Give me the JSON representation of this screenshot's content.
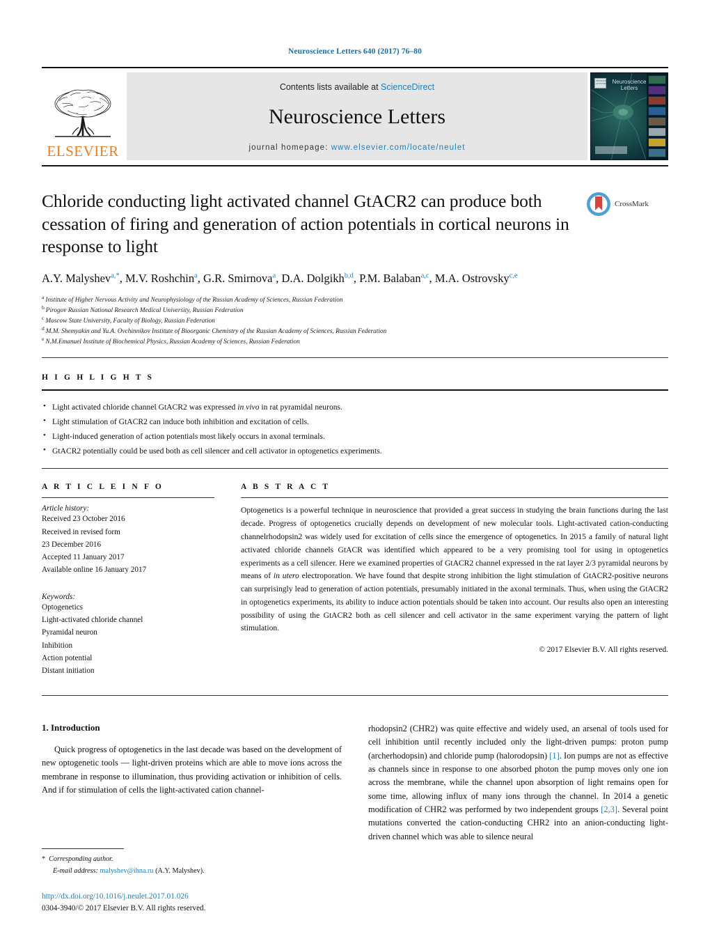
{
  "running_head": "Neuroscience Letters 640 (2017) 76–80",
  "masthead": {
    "publisher": "ELSEVIER",
    "contents_prefix": "Contents lists available at ",
    "contents_link": "ScienceDirect",
    "journal_title": "Neuroscience Letters",
    "homepage_prefix": "journal homepage: ",
    "homepage_url": "www.elsevier.com/locate/neulet",
    "cover_title": "Neuroscience Letters",
    "cover_badge": "NEUROSCIENCE LETTERS"
  },
  "article": {
    "title": "Chloride conducting light activated channel GtACR2 can produce both cessation of firing and generation of action potentials in cortical neurons in response to light",
    "crossmark_label": "CrossMark",
    "authors": [
      {
        "name": "A.Y. Malyshev",
        "marks": "a,*"
      },
      {
        "name": "M.V. Roshchin",
        "marks": "a"
      },
      {
        "name": "G.R. Smirnova",
        "marks": "a"
      },
      {
        "name": "D.A. Dolgikh",
        "marks": "b,d"
      },
      {
        "name": "P.M. Balaban",
        "marks": "a,c"
      },
      {
        "name": "M.A. Ostrovsky",
        "marks": "c,e"
      }
    ],
    "affiliations": [
      {
        "label": "a",
        "text": "Institute of Higher Nervous Activity and Neurophysiology of the Russian Academy of Sciences, Russian Federation"
      },
      {
        "label": "b",
        "text": "Pirogov Russian National Research Medical University, Russian Federation"
      },
      {
        "label": "c",
        "text": "Moscow State University, Faculty of Biology, Russian Federation"
      },
      {
        "label": "d",
        "text": "M.M. Shemyakin and Yu.A. Ovchinnikov Institute of Bioorganic Chemistry of the Russian Academy of Sciences, Russian Federation"
      },
      {
        "label": "e",
        "text": "N.M.Emanuel Institute of Biochemical Physics, Russian Academy of Sciences, Russian Federation"
      }
    ]
  },
  "highlights": {
    "heading": "H I G H L I G H T S",
    "items": [
      "Light activated chloride channel GtACR2 was expressed in vivo in rat pyramidal neurons.",
      "Light stimulation of GtACR2 can induce both inhibition and excitation of cells.",
      "Light-induced generation of action potentials most likely occurs in axonal terminals.",
      "GtACR2 potentially could be used both as cell silencer and cell activator in optogenetics experiments."
    ]
  },
  "article_info": {
    "heading": "A R T I C L E   I N F O",
    "history_label": "Article history:",
    "history": [
      "Received 23 October 2016",
      "Received in revised form",
      "23 December 2016",
      "Accepted 11 January 2017",
      "Available online 16 January 2017"
    ],
    "keywords_label": "Keywords:",
    "keywords": [
      "Optogenetics",
      "Light-activated chloride channel",
      "Pyramidal neuron",
      "Inhibition",
      "Action potential",
      "Distant initiation"
    ]
  },
  "abstract": {
    "heading": "A B S T R A C T",
    "text": "Optogenetics is a powerful technique in neuroscience that provided a great success in studying the brain functions during the last decade. Progress of optogenetics crucially depends on development of new molecular tools. Light-activated cation-conducting channelrhodopsin2 was widely used for excitation of cells since the emergence of optogenetics. In 2015 a family of natural light activated chloride channels GtACR was identified which appeared to be a very promising tool for using in optogenetics experiments as a cell silencer. Here we examined properties of GtACR2 channel expressed in the rat layer 2/3 pyramidal neurons by means of in utero electroporation. We have found that despite strong inhibition the light stimulation of GtACR2-positive neurons can surprisingly lead to generation of action potentials, presumably initiated in the axonal terminals. Thus, when using the GtACR2 in optogenetics experiments, its ability to induce action potentials should be taken into account. Our results also open an interesting possibility of using the GtACR2 both as cell silencer and cell activator in the same experiment varying the pattern of light stimulation.",
    "copyright": "© 2017 Elsevier B.V. All rights reserved."
  },
  "introduction": {
    "heading": "1.  Introduction",
    "left_paragraph": "Quick progress of optogenetics in the last decade was based on the development of new optogenetic tools — light-driven proteins which are able to move ions across the membrane in response to illumination, thus providing activation or inhibition of cells. And if for stimulation of cells the light-activated cation channel-",
    "right_paragraph_1": "rhodopsin2 (CHR2) was quite effective and widely used, an arsenal of tools used for cell inhibition until recently included only the light-driven pumps: proton pump (archerhodopsin) and chloride pump (halorodopsin) ",
    "ref_1": "[1]",
    "right_paragraph_2": ". Ion pumps are not as effective as channels since in response to one absorbed photon the pump moves only one ion across the membrane, while the channel upon absorption of light remains open for some time, allowing influx of many ions through the channel. In 2014 a genetic modification of CHR2 was performed by two independent groups ",
    "ref_2": "[2,3]",
    "right_paragraph_3": ". Several point mutations converted the cation-conducting CHR2 into an anion-conducting light-driven channel which was able to silence neural"
  },
  "footer": {
    "corresponding_star": "*",
    "corresponding_label": "Corresponding author.",
    "email_label": "E-mail address:",
    "email": "malyshev@ihna.ru",
    "email_suffix": "(A.Y. Malyshev).",
    "doi": "http://dx.doi.org/10.1016/j.neulet.2017.01.026",
    "issn_line": "0304-3940/© 2017 Elsevier B.V. All rights reserved."
  },
  "colors": {
    "link": "#1a7fc1",
    "elsevier_orange": "#ef7d22",
    "crossmark_blue": "#4aa3d8",
    "crossmark_red": "#d9453b"
  }
}
